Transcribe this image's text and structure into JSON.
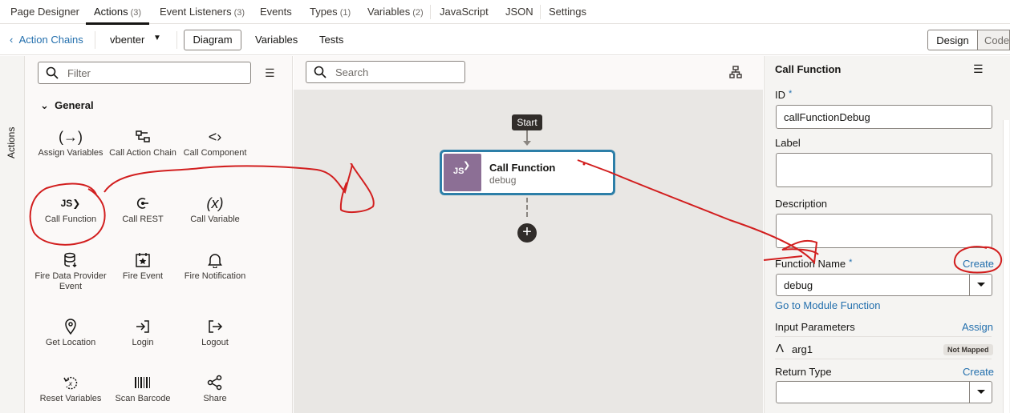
{
  "top_tabs": [
    {
      "label": "Page Designer",
      "count": ""
    },
    {
      "label": "Actions",
      "count": "(3)"
    },
    {
      "label": "Event Listeners",
      "count": "(3)"
    },
    {
      "label": "Events",
      "count": ""
    },
    {
      "label": "Types",
      "count": "(1)"
    },
    {
      "label": "Variables",
      "count": "(2)"
    },
    {
      "label": "JavaScript",
      "count": ""
    },
    {
      "label": "JSON",
      "count": ""
    },
    {
      "label": "Settings",
      "count": ""
    }
  ],
  "subbar": {
    "back_label": "Action Chains",
    "chain_name": "vbenter",
    "diagram": "Diagram",
    "variables": "Variables",
    "tests": "Tests",
    "design": "Design",
    "code": "Code"
  },
  "sidebar_tab": "Actions",
  "palette": {
    "filter_placeholder": "Filter",
    "section": "General",
    "items": [
      "Assign Variables",
      "Call Action Chain",
      "Call Component",
      "Call Function",
      "Call REST",
      "Call Variable",
      "Fire Data Provider Event",
      "Fire Event",
      "Fire Notification",
      "Get Location",
      "Login",
      "Logout",
      "Reset Variables",
      "Scan Barcode",
      "Share"
    ]
  },
  "canvas": {
    "search_placeholder": "Search",
    "start_label": "Start",
    "node_title": "Call Function",
    "node_subtitle": "debug",
    "node_tile_text": "JS"
  },
  "properties": {
    "title": "Call Function",
    "id_label": "ID",
    "id_value": "callFunctionDebug",
    "label_label": "Label",
    "description_label": "Description",
    "function_name_label": "Function Name",
    "create_link": "Create",
    "function_name_value": "debug",
    "module_link": "Go to Module Function",
    "input_params_label": "Input Parameters",
    "assign_link": "Assign",
    "param_name": "arg1",
    "param_status": "Not Mapped",
    "return_type_label": "Return Type",
    "return_create_link": "Create",
    "required_mark": "*"
  },
  "colors": {
    "accent": "#236fad",
    "node_border": "#2d7fa8",
    "annotation": "#d21f1f"
  }
}
